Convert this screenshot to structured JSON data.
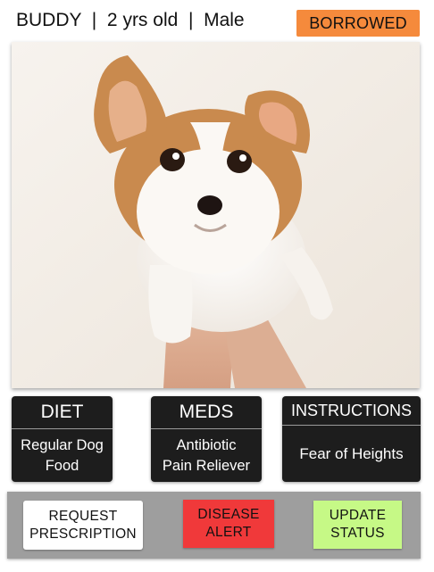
{
  "header": {
    "pet_info": "BUDDY  |  2 yrs old  |  Male",
    "status": "BORROWED",
    "status_color": "#f58a3c"
  },
  "photo": {
    "icon": "puppy-photo"
  },
  "cards": {
    "diet": {
      "title": "DIET",
      "body": "Regular Dog\nFood"
    },
    "meds": {
      "title": "MEDS",
      "body": "Antibiotic\nPain Reliever"
    },
    "instructions": {
      "title": "INSTRUCTIONS",
      "body": "Fear of Heights"
    }
  },
  "actions": {
    "request_prescription": "REQUEST\nPRESCRIPTION",
    "disease_alert": "DISEASE\nALERT",
    "update_status": "UPDATE\nSTATUS",
    "colors": {
      "request": "#ffffff",
      "disease": "#f0393a",
      "update": "#c6f986"
    }
  }
}
